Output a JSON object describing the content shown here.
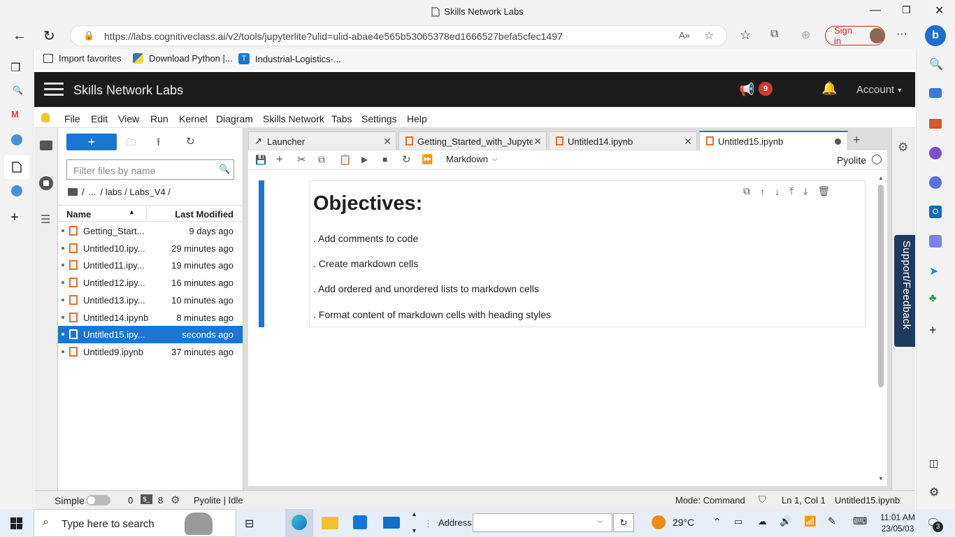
{
  "browser": {
    "window_title": "Skills Network Labs",
    "url": "https://labs.cognitiveclass.ai/v2/tools/jupyterlite?ulid=ulid-abae4e565b53065378ed1666527befa5cfec1497",
    "sign_in_label": "Sign in",
    "favorites": [
      "Import favorites",
      "Download Python |...",
      "Industrial-Logistics-..."
    ]
  },
  "header": {
    "title": "Skills Network Labs",
    "notification_count": "9",
    "account_label": "Account"
  },
  "menu": [
    "File",
    "Edit",
    "View",
    "Run",
    "Kernel",
    "Diagram",
    "Skills Network",
    "Tabs",
    "Settings",
    "Help"
  ],
  "filebrowser": {
    "new_button": "+",
    "filter_placeholder": "Filter files by name",
    "breadcrumb": [
      "/",
      "...",
      "/ labs / Labs_V4 /"
    ],
    "col_name": "Name",
    "col_modified": "Last Modified",
    "files": [
      {
        "name": "Getting_Start...",
        "modified": "9 days ago"
      },
      {
        "name": "Untitled10.ipy...",
        "modified": "29 minutes ago"
      },
      {
        "name": "Untitled11.ipy...",
        "modified": "19 minutes ago"
      },
      {
        "name": "Untitled12.ipy...",
        "modified": "16 minutes ago"
      },
      {
        "name": "Untitled13.ipy...",
        "modified": "10 minutes ago"
      },
      {
        "name": "Untitled14.ipynb",
        "modified": "8 minutes ago"
      },
      {
        "name": "Untitled15.ipy...",
        "modified": "seconds ago"
      },
      {
        "name": "Untitled9.ipynb",
        "modified": "37 minutes ago"
      }
    ]
  },
  "tabs": [
    {
      "label": "Launcher"
    },
    {
      "label": "Getting_Started_with_Jupyter"
    },
    {
      "label": "Untitled14.ipynb"
    },
    {
      "label": "Untitled15.ipynb"
    }
  ],
  "notebook": {
    "cell_type": "Markdown",
    "kernel": "Pyolite",
    "heading": "Objectives:",
    "lines": [
      ". Add comments to code",
      ". Create markdown cells",
      ". Add ordered and unordered lists to markdown cells",
      ". Format content of markdown cells with heading styles"
    ]
  },
  "support_label": "Support/Feedback",
  "status": {
    "simple_label": "Simple",
    "count1": "0",
    "count2": "8",
    "kernel_status": "Pyolite | Idle",
    "mode": "Mode: Command",
    "position": "Ln 1, Col 1",
    "file": "Untitled15.ipynb"
  },
  "taskbar": {
    "search_placeholder": "Type here to search",
    "address_label": "Address",
    "temperature": "29°C",
    "time": "11:01 AM",
    "date": "23/05/03",
    "notif_count": "3"
  }
}
